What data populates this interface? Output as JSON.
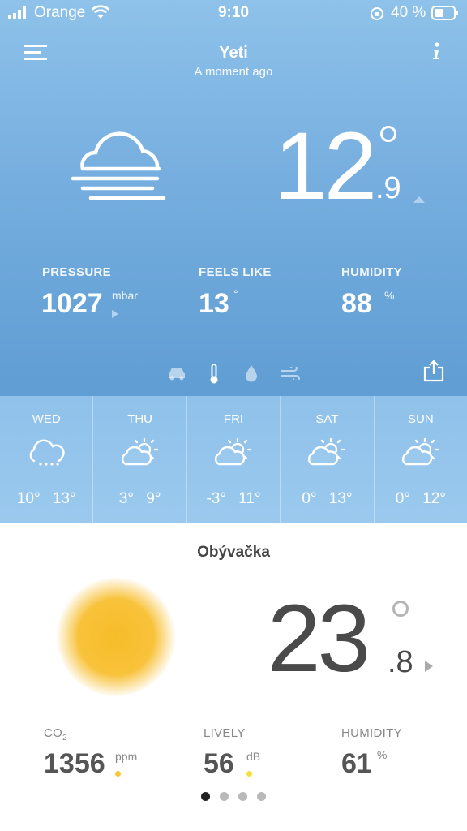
{
  "status_bar": {
    "carrier": "Orange",
    "time": "9:10",
    "battery": "40 %"
  },
  "header": {
    "station_name": "Yeti",
    "updated": "A moment ago",
    "menu_icon": "hamburger-menu-icon",
    "info_icon": "info-icon"
  },
  "outdoor": {
    "condition_icon": "fog-icon",
    "temp_int": "12",
    "temp_dec": ".9",
    "trend": "up",
    "pressure": {
      "label": "PRESSURE",
      "value": "1027",
      "unit": "mbar"
    },
    "feels_like": {
      "label": "FEELS LIKE",
      "value": "13",
      "unit": "°"
    },
    "humidity": {
      "label": "HUMIDITY",
      "value": "88",
      "unit": "%"
    },
    "module_icons": [
      "car-icon",
      "thermometer-icon",
      "drop-icon",
      "wind-icon"
    ],
    "share_icon": "share-icon"
  },
  "forecast": [
    {
      "day": "WED",
      "icon": "cloud-rain-icon",
      "low": "10°",
      "high": "13°"
    },
    {
      "day": "THU",
      "icon": "partly-cloudy-icon",
      "low": "3°",
      "high": "9°"
    },
    {
      "day": "FRI",
      "icon": "partly-cloudy-icon",
      "low": "-3°",
      "high": "11°"
    },
    {
      "day": "SAT",
      "icon": "partly-cloudy-icon",
      "low": "0°",
      "high": "13°"
    },
    {
      "day": "SUN",
      "icon": "partly-cloudy-icon",
      "low": "0°",
      "high": "12°"
    }
  ],
  "indoor": {
    "room": "Obývačka",
    "temp_int": "23",
    "temp_dec": ".8",
    "co2": {
      "label": "CO",
      "sub": "2",
      "value": "1356",
      "unit": "ppm",
      "status_color": "#f6c53a"
    },
    "noise": {
      "label": "LIVELY",
      "value": "56",
      "unit": "dB",
      "status_color": "#f6e03a"
    },
    "humidity": {
      "label": "HUMIDITY",
      "value": "61",
      "unit": "%"
    }
  },
  "pager": {
    "count": 4,
    "active": 0
  }
}
